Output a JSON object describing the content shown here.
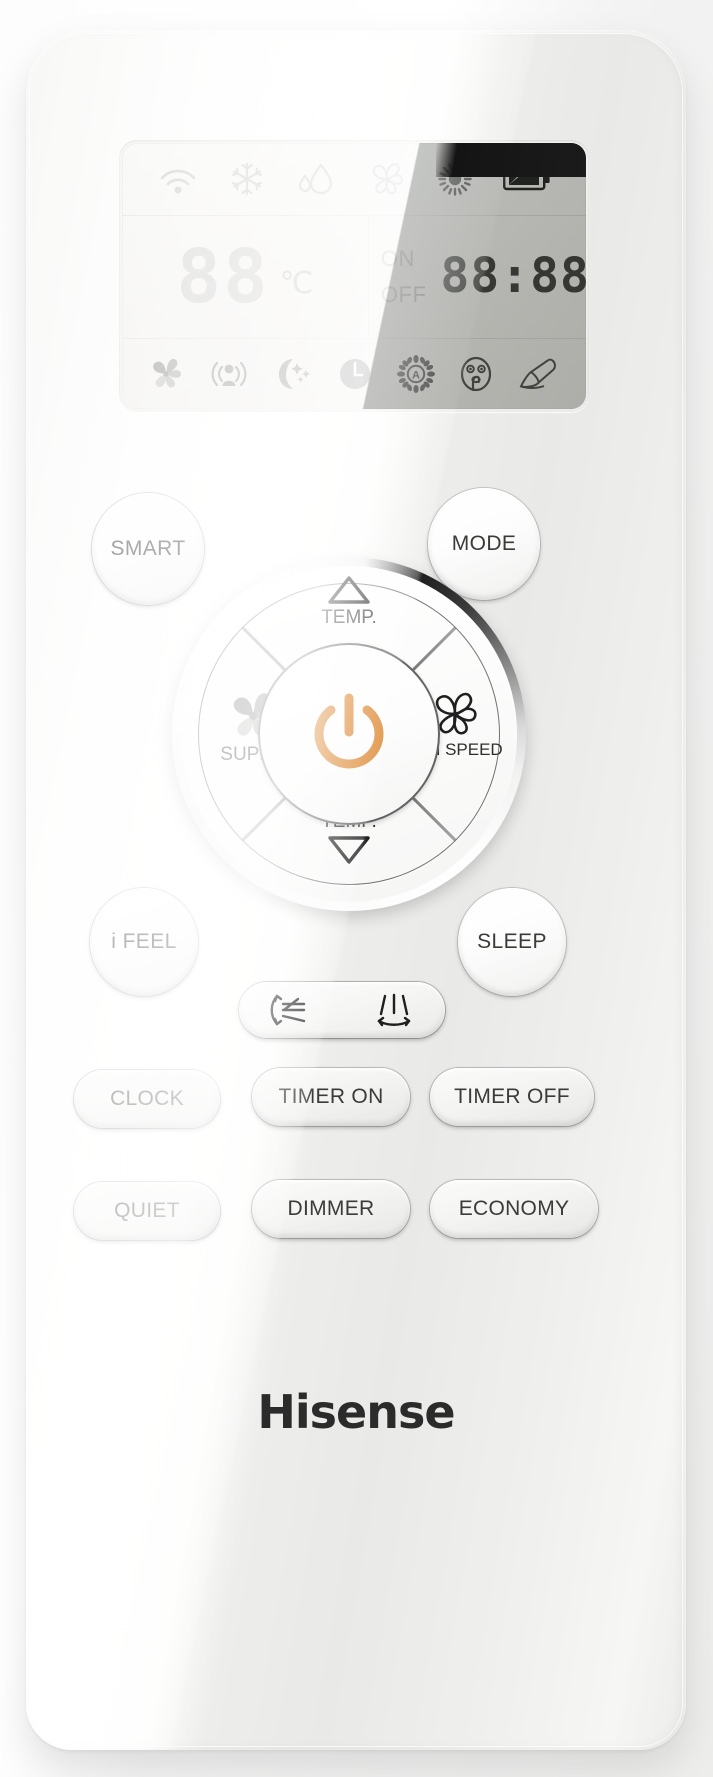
{
  "device": {
    "brand": "Hisense",
    "type": "air-conditioner-remote-control"
  },
  "display": {
    "status_icons": [
      {
        "name": "signal-icon",
        "label": "signal"
      },
      {
        "name": "snowflake-icon",
        "label": "cool"
      },
      {
        "name": "water-drop-icon",
        "label": "dry"
      },
      {
        "name": "fan-icon",
        "label": "fan"
      },
      {
        "name": "sun-icon",
        "label": "heat"
      },
      {
        "name": "battery-icon",
        "label": "battery"
      }
    ],
    "temperature": "88",
    "temperature_unit": "℃",
    "timer_on_label": "ON",
    "timer_off_label": "OFF",
    "clock": "88:88",
    "feature_icons": [
      {
        "name": "super-spiral-icon",
        "label": "super"
      },
      {
        "name": "ifeel-person-icon",
        "label": "i feel"
      },
      {
        "name": "moon-stars-icon",
        "label": "sleep"
      },
      {
        "name": "clock-icon",
        "label": "clock"
      },
      {
        "name": "auto-fan-icon",
        "label": "auto"
      },
      {
        "name": "quiet-face-icon",
        "label": "quiet"
      },
      {
        "name": "economy-icon",
        "label": "economy"
      }
    ]
  },
  "buttons": {
    "smart": "SMART",
    "mode": "MODE",
    "temp_up": "TEMP.",
    "temp_down": "TEMP.",
    "super": "SUPER",
    "fan_speed": "FAN SPEED",
    "power": "power",
    "ifeel": "i FEEL",
    "sleep": "SLEEP",
    "swing_vertical": "vertical-swing",
    "swing_horizontal": "horizontal-swing",
    "clock": "CLOCK",
    "timer_on": "TIMER ON",
    "timer_off": "TIMER OFF",
    "quiet": "QUIET",
    "dimmer": "DIMMER",
    "economy": "ECONOMY"
  },
  "colors": {
    "power_accent": "#DC842A",
    "body": "#f4f4f2",
    "lcd": "#ecebe7",
    "text": "#2f2f2d"
  }
}
